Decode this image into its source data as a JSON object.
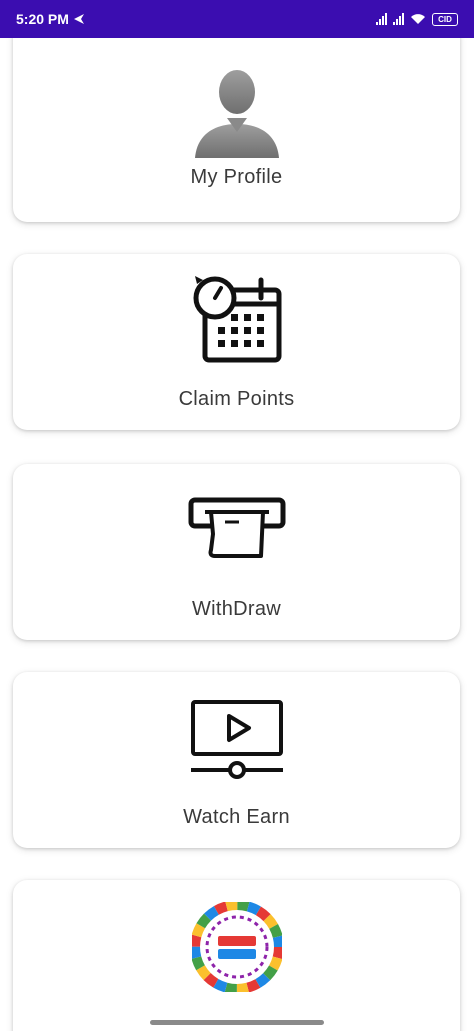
{
  "status_bar": {
    "time": "5:20 PM",
    "battery": "CID",
    "bg_color": "#3b0db0"
  },
  "menu": {
    "items": [
      {
        "label": "My Profile",
        "icon": "user-avatar-icon"
      },
      {
        "label": "Claim Points",
        "icon": "calendar-clock-icon"
      },
      {
        "label": "WithDraw",
        "icon": "withdraw-receipt-icon"
      },
      {
        "label": "Watch Earn",
        "icon": "video-play-icon"
      },
      {
        "label": "",
        "icon": "spin-wheel-icon"
      }
    ]
  }
}
